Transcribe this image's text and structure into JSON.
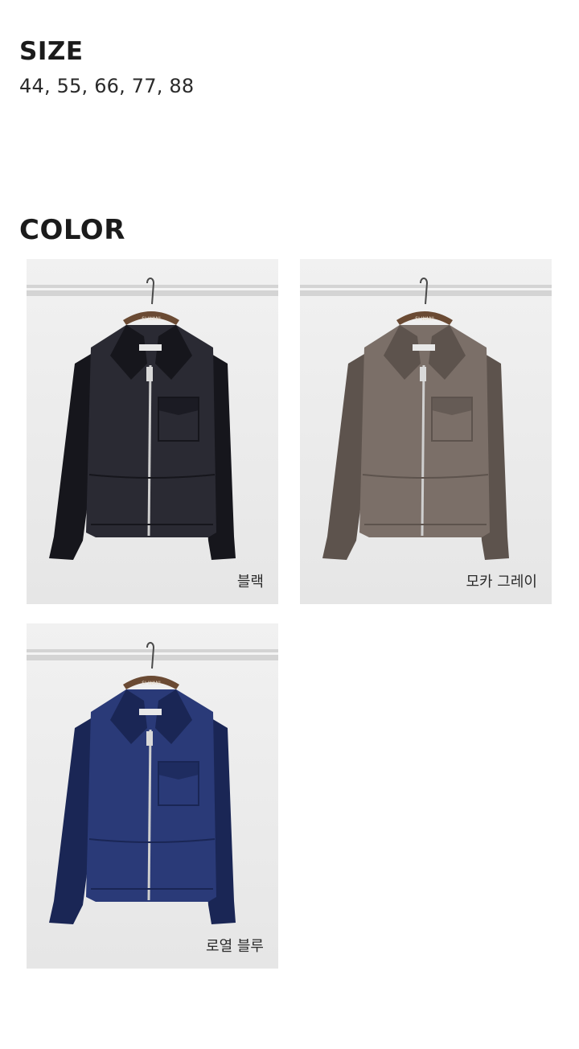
{
  "size": {
    "title": "SIZE",
    "values": "44, 55, 66, 77, 88"
  },
  "color": {
    "title": "COLOR",
    "swatches": [
      {
        "label": "블랙",
        "jacket_color": "#2a2a33",
        "shade_color": "#16161c"
      },
      {
        "label": "모카 그레이",
        "jacket_color": "#7b6f68",
        "shade_color": "#5d534d"
      },
      {
        "label": "로열 블루",
        "jacket_color": "#2a3a78",
        "shade_color": "#1a2655"
      }
    ]
  },
  "hanger_label": "SI WANI"
}
